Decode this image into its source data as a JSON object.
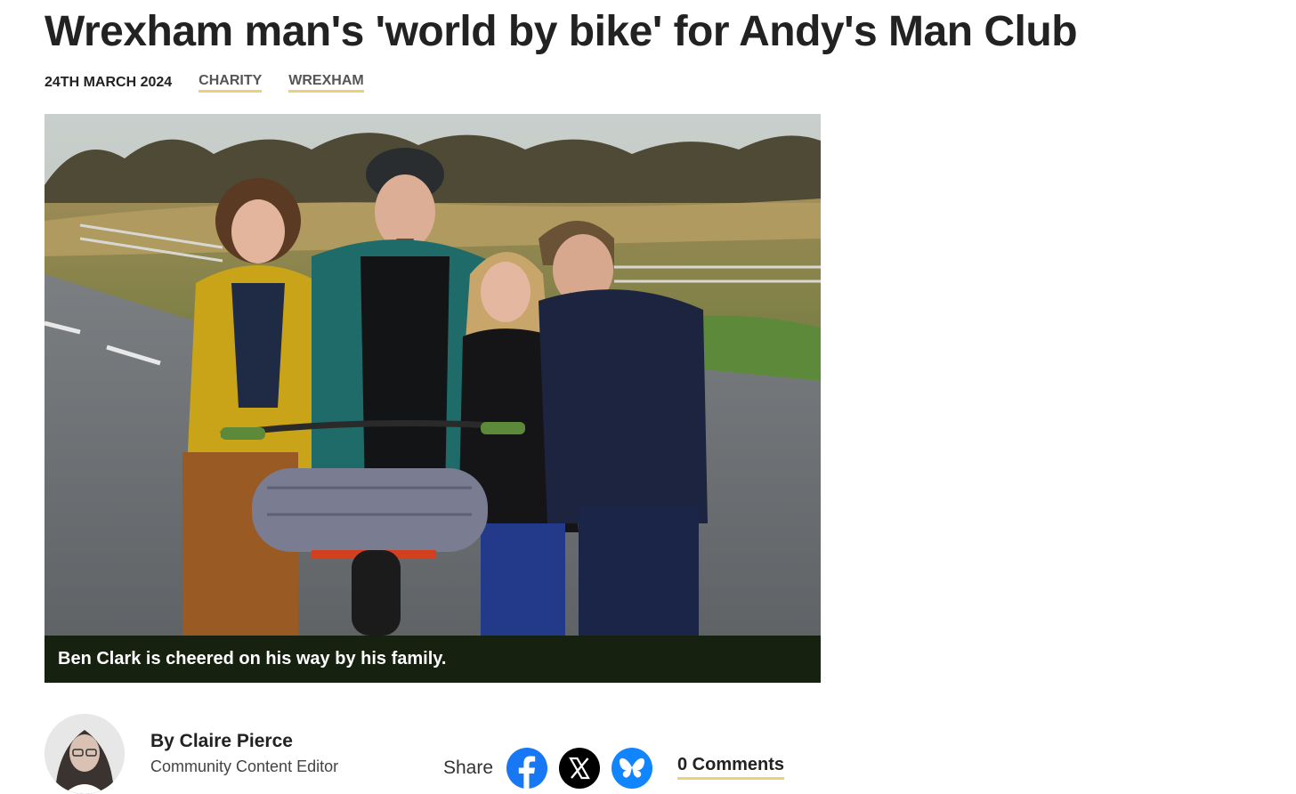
{
  "article": {
    "headline": "Wrexham man's 'world by bike' for Andy's Man Club",
    "date": "24TH MARCH 2024",
    "tags": [
      "CHARITY",
      "WREXHAM"
    ],
    "caption": "Ben Clark is cheered on his way by his family."
  },
  "author": {
    "name": "By Claire Pierce",
    "role": "Community Content Editor"
  },
  "share": {
    "label": "Share",
    "buttons": [
      {
        "icon": "facebook-icon",
        "color": "#1877f2"
      },
      {
        "icon": "x-icon",
        "color": "#000000"
      },
      {
        "icon": "bluesky-icon",
        "color": "#1185fe"
      }
    ]
  },
  "comments": {
    "label": "0 Comments"
  },
  "colors": {
    "tag_underline": "#e9d27a",
    "caption_bg": "#17210f"
  }
}
